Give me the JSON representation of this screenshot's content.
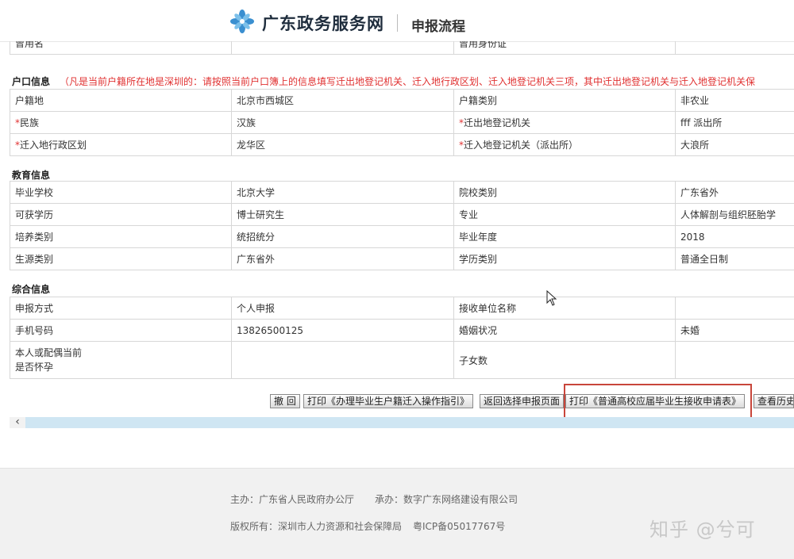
{
  "header": {
    "site_name": "广东政务服务网",
    "subtitle": "申报流程",
    "brand_color": "#3a8fd0"
  },
  "top_partial_row": {
    "label": "曾用名",
    "label2": "曾用身份证"
  },
  "household": {
    "title": "户口信息",
    "note": "（凡是当前户籍所在地是深圳的：请按照当前户口簿上的信息填写迁出地登记机关、迁入地行政区划、迁入地登记机关三项，其中迁出地登记机关与迁入地登记机关保",
    "rows": [
      {
        "l1": "户籍地",
        "r1": false,
        "v1": "北京市西城区",
        "l2": "户籍类别",
        "r2": false,
        "v2": "非农业"
      },
      {
        "l1": "民族",
        "r1": true,
        "v1": "汉族",
        "l2": "迁出地登记机关",
        "r2": true,
        "v2": "fff 派出所"
      },
      {
        "l1": "迁入地行政区划",
        "r1": true,
        "v1": "龙华区",
        "l2": "迁入地登记机关（派出所）",
        "r2": true,
        "v2": "大浪所"
      }
    ]
  },
  "education": {
    "title": "教育信息",
    "rows": [
      {
        "l1": "毕业学校",
        "v1": "北京大学",
        "l2": "院校类别",
        "v2": "广东省外"
      },
      {
        "l1": "可获学历",
        "v1": "博士研究生",
        "l2": "专业",
        "v2": "人体解剖与组织胚胎学"
      },
      {
        "l1": "培养类别",
        "v1": "统招统分",
        "l2": "毕业年度",
        "v2": "2018"
      },
      {
        "l1": "生源类别",
        "v1": "广东省外",
        "l2": "学历类别",
        "v2": "普通全日制"
      }
    ]
  },
  "general": {
    "title": "综合信息",
    "rows": [
      {
        "l1": "申报方式",
        "v1": "个人申报",
        "l2": "接收单位名称",
        "v2": ""
      },
      {
        "l1": "手机号码",
        "v1": "13826500125",
        "l2": "婚姻状况",
        "v2": "未婚"
      }
    ],
    "pregnancy_label_1": "本人或配偶当前",
    "pregnancy_label_2": "是否怀孕",
    "pregnancy_value": "",
    "children_label": "子女数",
    "children_value": ""
  },
  "buttons": {
    "withdraw": "撤 回",
    "print_guide": "打印《办理毕业生户籍迁入操作指引》",
    "back": "返回选择申报页面",
    "print_form": "打印《普通高校应届毕业生接收申请表》",
    "history": "查看历史"
  },
  "footer": {
    "host": "主办：广东省人民政府办公厅",
    "builder": "承办：数字广东网络建设有限公司",
    "copyright": "版权所有：深圳市人力资源和社会保障局",
    "icp": "粤ICP备05017767号"
  },
  "watermark": "知乎 @兮可",
  "colors": {
    "required_star": "#e03131",
    "highlight": "#c8463b",
    "scrollbar": "#cfe6f3"
  }
}
